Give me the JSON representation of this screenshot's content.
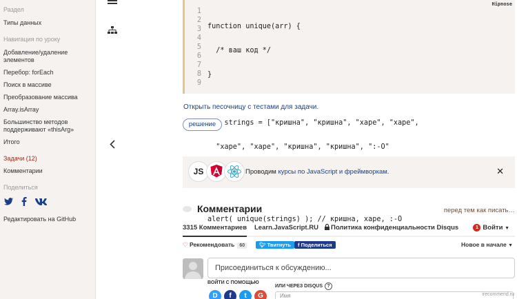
{
  "sidebar": {
    "section_label": "Раздел",
    "section_item": "Типы данных",
    "nav_label": "Навигация по уроку",
    "items": [
      "Добавление/удаление элементов",
      "Перебор: forEach",
      "Поиск в массиве",
      "Преобразование массива",
      "Array.isArray",
      "Большинство методов поддерживают «thisArg»",
      "Итого"
    ],
    "tasks": "Задачи (12)",
    "comments": "Комментарии",
    "share_label": "Поделиться",
    "github": "Редактировать на GitHub"
  },
  "code": {
    "line_numbers": [
      "1",
      "2",
      "3",
      "4",
      "5",
      "6",
      "7",
      "8",
      "9"
    ],
    "lines": [
      "function unique(arr) {",
      "  /* ваш код */",
      "}",
      "",
      "let strings = [\"кришна\", \"кришна\", \"харе\", \"харе\",",
      "  \"харе\", \"харе\", \"кришна\", \"кришна\", \":-O\"",
      "];",
      "",
      "alert( unique(strings) ); // кришна, харе, :-O"
    ],
    "corner_label": "Hipnose"
  },
  "task": {
    "sandbox_link": "Открыть песочницу с тестами для задачи.",
    "solution_button": "решение"
  },
  "banner": {
    "text_before": "Проводим ",
    "link": "курсы по JavaScript и фреймворкам",
    "text_after": ".",
    "js_logo": "JS",
    "close": "✕"
  },
  "comments": {
    "title": "Комментарии",
    "before_posting": "перед тем как писать…",
    "tab_count": "3315 Комментариев",
    "tab_site": "Learn.JavaScript.RU",
    "tab_privacy": "Политика конфиденциальности Disqus",
    "notif_count": "1",
    "login": "Войти",
    "recommend": "Рекомендовать",
    "recommend_count": "60",
    "tweet": "Твитнуть",
    "share": "Поделиться",
    "sort": "Новое в начале",
    "join_placeholder": "Присоединиться к обсуждению...",
    "login_with": "ВОЙТИ С ПОМОЩЬЮ",
    "or_disqus": "ИЛИ ЧЕРЕЗ DISQUS",
    "name_placeholder": "Имя"
  },
  "colors": {
    "accent_red": "#a32a1a",
    "link_blue": "#1a3f88",
    "twitter": "#1d9bf0",
    "facebook": "#1e3a8a"
  },
  "watermark": "irecommend.ru"
}
